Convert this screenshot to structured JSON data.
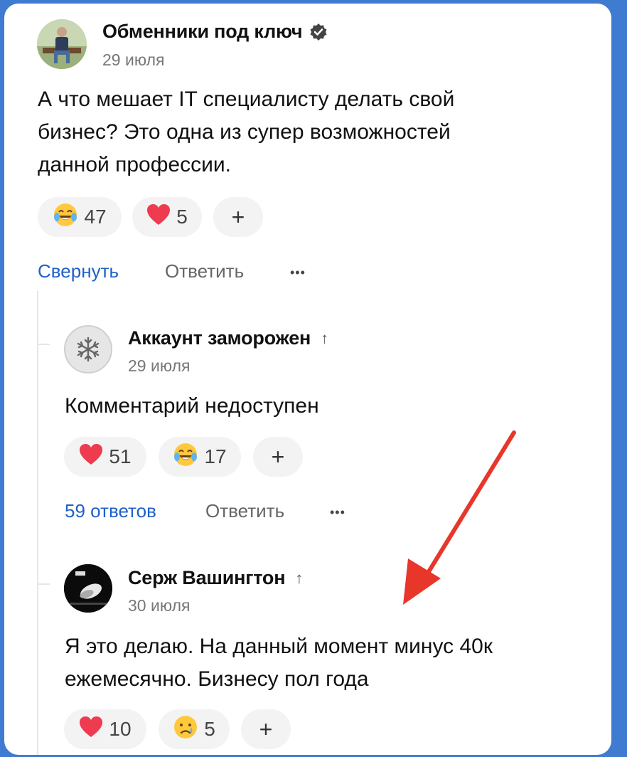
{
  "post": {
    "author": "Обменники под ключ",
    "verified_icon": "verified-badge-icon",
    "date": "29 июля",
    "text_lines": [
      "А что мешает IT специалисту делать свой",
      "бизнес? Это одна из супер возможностей",
      "данной профессии."
    ],
    "reactions": [
      {
        "icon": "laughing-tears-emoji",
        "count": "47"
      },
      {
        "icon": "heart-emoji",
        "count": "5"
      }
    ],
    "add_reaction": "+",
    "actions": {
      "collapse": "Свернуть",
      "reply": "Ответить",
      "more": "•••"
    }
  },
  "comments": [
    {
      "author": "Аккаунт заморожен",
      "up_arrow": "↑",
      "date": "29 июля",
      "text_lines": [
        "Комментарий недоступен"
      ],
      "reactions": [
        {
          "icon": "heart-emoji",
          "count": "51"
        },
        {
          "icon": "laughing-tears-emoji",
          "count": "17"
        }
      ],
      "add_reaction": "+",
      "actions": {
        "replies": "59 ответов",
        "reply": "Ответить",
        "more": "•••"
      }
    },
    {
      "author": "Серж Вашингтон",
      "up_arrow": "↑",
      "date": "30 июля",
      "text_lines": [
        "Я это делаю. На данный момент минус 40к",
        "ежемесячно. Бизнесу пол года"
      ],
      "reactions": [
        {
          "icon": "heart-emoji",
          "count": "10"
        },
        {
          "icon": "sad-tear-emoji",
          "count": "5"
        }
      ],
      "add_reaction": "+"
    }
  ],
  "colors": {
    "accent": "#1f5fc9",
    "frame": "#3f7bd0",
    "annotation_arrow": "#e8362a"
  }
}
